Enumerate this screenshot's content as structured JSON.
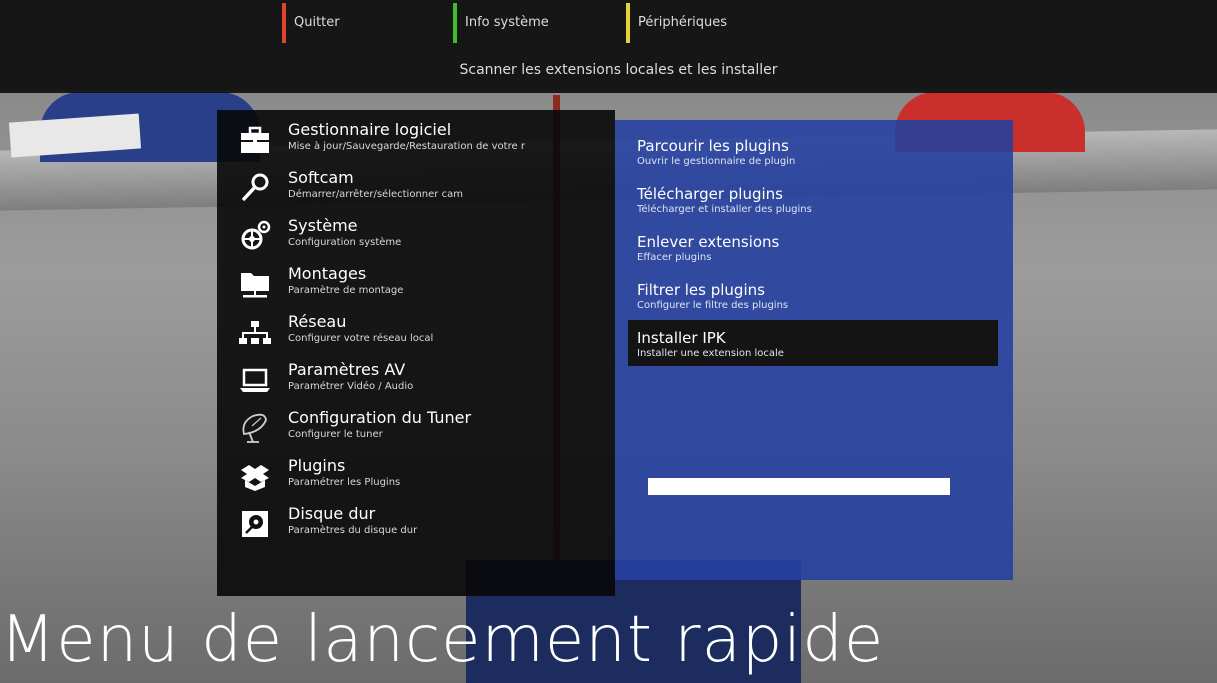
{
  "colorkeys": [
    {
      "label": "Quitter",
      "color": "#e0422b"
    },
    {
      "label": "Info système",
      "color": "#3bbf2a"
    },
    {
      "label": "Périphériques",
      "color": "#e4d23a"
    }
  ],
  "hint": "Scanner les extensions locales et les installer",
  "menu": {
    "items": [
      {
        "title": "Gestionnaire logiciel",
        "subtitle": "Mise à jour/Sauvegarde/Restauration de votre r",
        "icon": "briefcase-icon"
      },
      {
        "title": "Softcam",
        "subtitle": "Démarrer/arrêter/sélectionner cam",
        "icon": "key-icon"
      },
      {
        "title": "Système",
        "subtitle": "Configuration système",
        "icon": "gears-icon"
      },
      {
        "title": "Montages",
        "subtitle": "Paramètre de montage",
        "icon": "folder-network-icon"
      },
      {
        "title": "Réseau",
        "subtitle": "Configurer votre réseau local",
        "icon": "network-icon"
      },
      {
        "title": "Paramètres AV",
        "subtitle": "Paramétrer Vidéo / Audio",
        "icon": "laptop-icon"
      },
      {
        "title": "Configuration du Tuner",
        "subtitle": "Configurer le tuner",
        "icon": "satellite-dish-icon"
      },
      {
        "title": "Plugins",
        "subtitle": "Paramétrer les Plugins",
        "icon": "box-icon"
      },
      {
        "title": "Disque dur",
        "subtitle": "Paramètres du disque dur",
        "icon": "hard-disk-icon"
      }
    ]
  },
  "submenu": {
    "selected_index": 4,
    "items": [
      {
        "title": "Parcourir les plugins",
        "desc": "Ouvrir le gestionnaire de plugin"
      },
      {
        "title": "Télécharger plugins",
        "desc": "Télécharger et installer des plugins"
      },
      {
        "title": "Enlever extensions",
        "desc": "Effacer plugins"
      },
      {
        "title": "Filtrer les plugins",
        "desc": "Configurer le filtre des plugins"
      },
      {
        "title": "Installer IPK",
        "desc": "Installer une extension locale"
      }
    ]
  },
  "page_title": "Menu de lancement rapide"
}
